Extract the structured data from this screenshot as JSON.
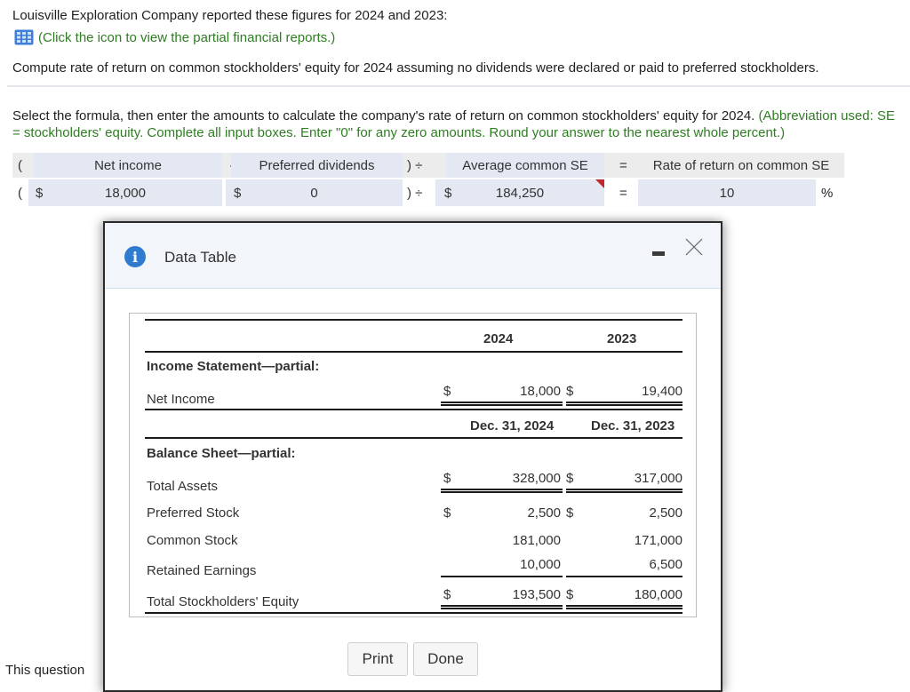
{
  "question": {
    "intro": "Louisville Exploration Company reported these figures for 2024 and 2023:",
    "link_text": "(Click the icon to view the partial financial reports.)",
    "compute": "Compute rate of return on common stockholders' equity for 2024 assuming no dividends were declared or paid to preferred stockholders.",
    "instruction_main": "Select the formula, then enter the amounts to calculate the company's rate of return on common stockholders' equity for 2024.",
    "instruction_green": "(Abbreviation used: SE = stockholders' equity. Complete all input boxes. Enter \"0\" for any zero amounts. Round your answer to the nearest whole percent.)"
  },
  "formula": {
    "open_paren": "(",
    "minus": "-",
    "close_div": ") ÷",
    "equals": "=",
    "dollar": "$",
    "percent": "%",
    "headers": {
      "net_income": "Net income",
      "preferred_dividends": "Preferred dividends",
      "average_common_se": "Average common SE",
      "rate_of_return": "Rate of return on common SE"
    },
    "values": {
      "net_income": "18,000",
      "preferred_dividends": "0",
      "average_common_se": "184,250",
      "rate_of_return": "10"
    },
    "colors": {
      "input_bg": "#e3e8f2",
      "error_flag": "#c0282d",
      "instruction_green": "#2e7d22"
    }
  },
  "background": {
    "partial_text": "This question"
  },
  "modal": {
    "title": "Data Table",
    "minimize_label": "minimize",
    "close_label": "close",
    "table": {
      "year_headers": [
        "2024",
        "2023"
      ],
      "income_section": "Income Statement—partial:",
      "net_income": {
        "label": "Net Income",
        "v2024": "18,000",
        "v2023": "19,400"
      },
      "date_headers": [
        "Dec. 31, 2024",
        "Dec. 31, 2023"
      ],
      "balance_section": "Balance Sheet—partial:",
      "rows": [
        {
          "label": "Total Assets",
          "v2024": "328,000",
          "v2023": "317,000"
        },
        {
          "label": "Preferred Stock",
          "v2024": "2,500",
          "v2023": "2,500"
        },
        {
          "label": "Common Stock",
          "v2024": "181,000",
          "v2023": "171,000"
        },
        {
          "label": "Retained Earnings",
          "v2024": "10,000",
          "v2023": "6,500"
        },
        {
          "label": "Total Stockholders' Equity",
          "v2024": "193,500",
          "v2023": "180,000"
        }
      ],
      "dollar": "$"
    },
    "buttons": {
      "print": "Print",
      "done": "Done"
    }
  }
}
